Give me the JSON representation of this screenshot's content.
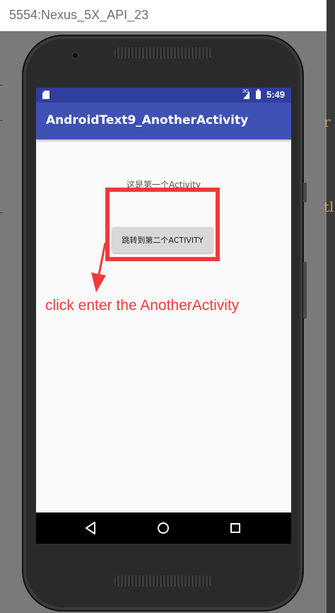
{
  "emulator": {
    "window_title": "5554:Nexus_5X_API_23"
  },
  "status_bar": {
    "network_label": "3G",
    "time": "5:49",
    "icons": [
      "sd-card-icon",
      "signal-icon",
      "battery-icon"
    ]
  },
  "app_bar": {
    "title": "AndroidText9_AnotherActivity"
  },
  "content": {
    "hello_text": "这是第一个Activity",
    "jump_button_label": "跳转到第二个ACTIVITY"
  },
  "annotation": {
    "text": "click enter the AnotherActivity",
    "color": "#f03a3a"
  },
  "nav_bar": {
    "buttons": [
      "back-icon",
      "home-icon",
      "recents-icon"
    ]
  },
  "colors": {
    "status_bar": "#303f9f",
    "app_bar": "#3f51b5",
    "screen_bg": "#fafafa",
    "highlight": "#f03a3a"
  }
}
